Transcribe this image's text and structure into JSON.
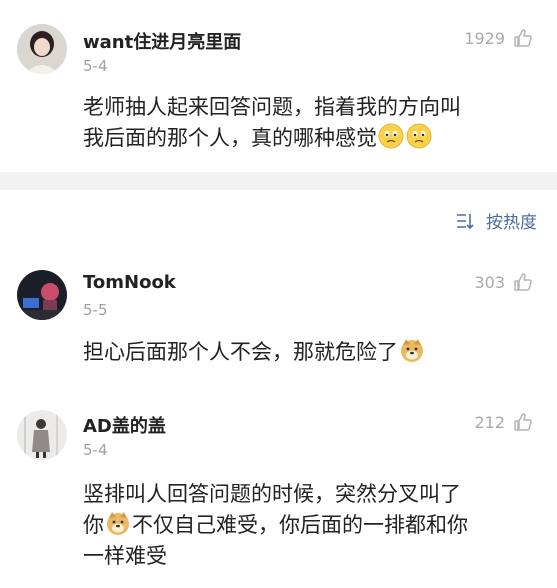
{
  "post": {
    "username": "want住进月亮里面",
    "date": "5-4",
    "likes": "1929",
    "text_line1": "老师抽人起来回答问题，指着我的方向叫",
    "text_line2": "我后面的那个人，真的哪种感觉"
  },
  "sort": {
    "label": "按热度",
    "icon": "sort-icon"
  },
  "comments": [
    {
      "username": "TomNook",
      "date": "5-5",
      "likes": "303",
      "text_before": "担心后面那个人不会，那就危险了"
    },
    {
      "username": "AD盖的盖",
      "date": "5-4",
      "likes": "212",
      "line1": "竖排叫人回答问题的时候，突然分叉叫了",
      "line2_a": "你",
      "line2_b": "不仅自己难受，你后面的一排都和你",
      "line3": "一样难受"
    }
  ],
  "colors": {
    "accent": "#4a6f9e",
    "muted": "#a0a0a0",
    "band": "#f2f2f2"
  }
}
